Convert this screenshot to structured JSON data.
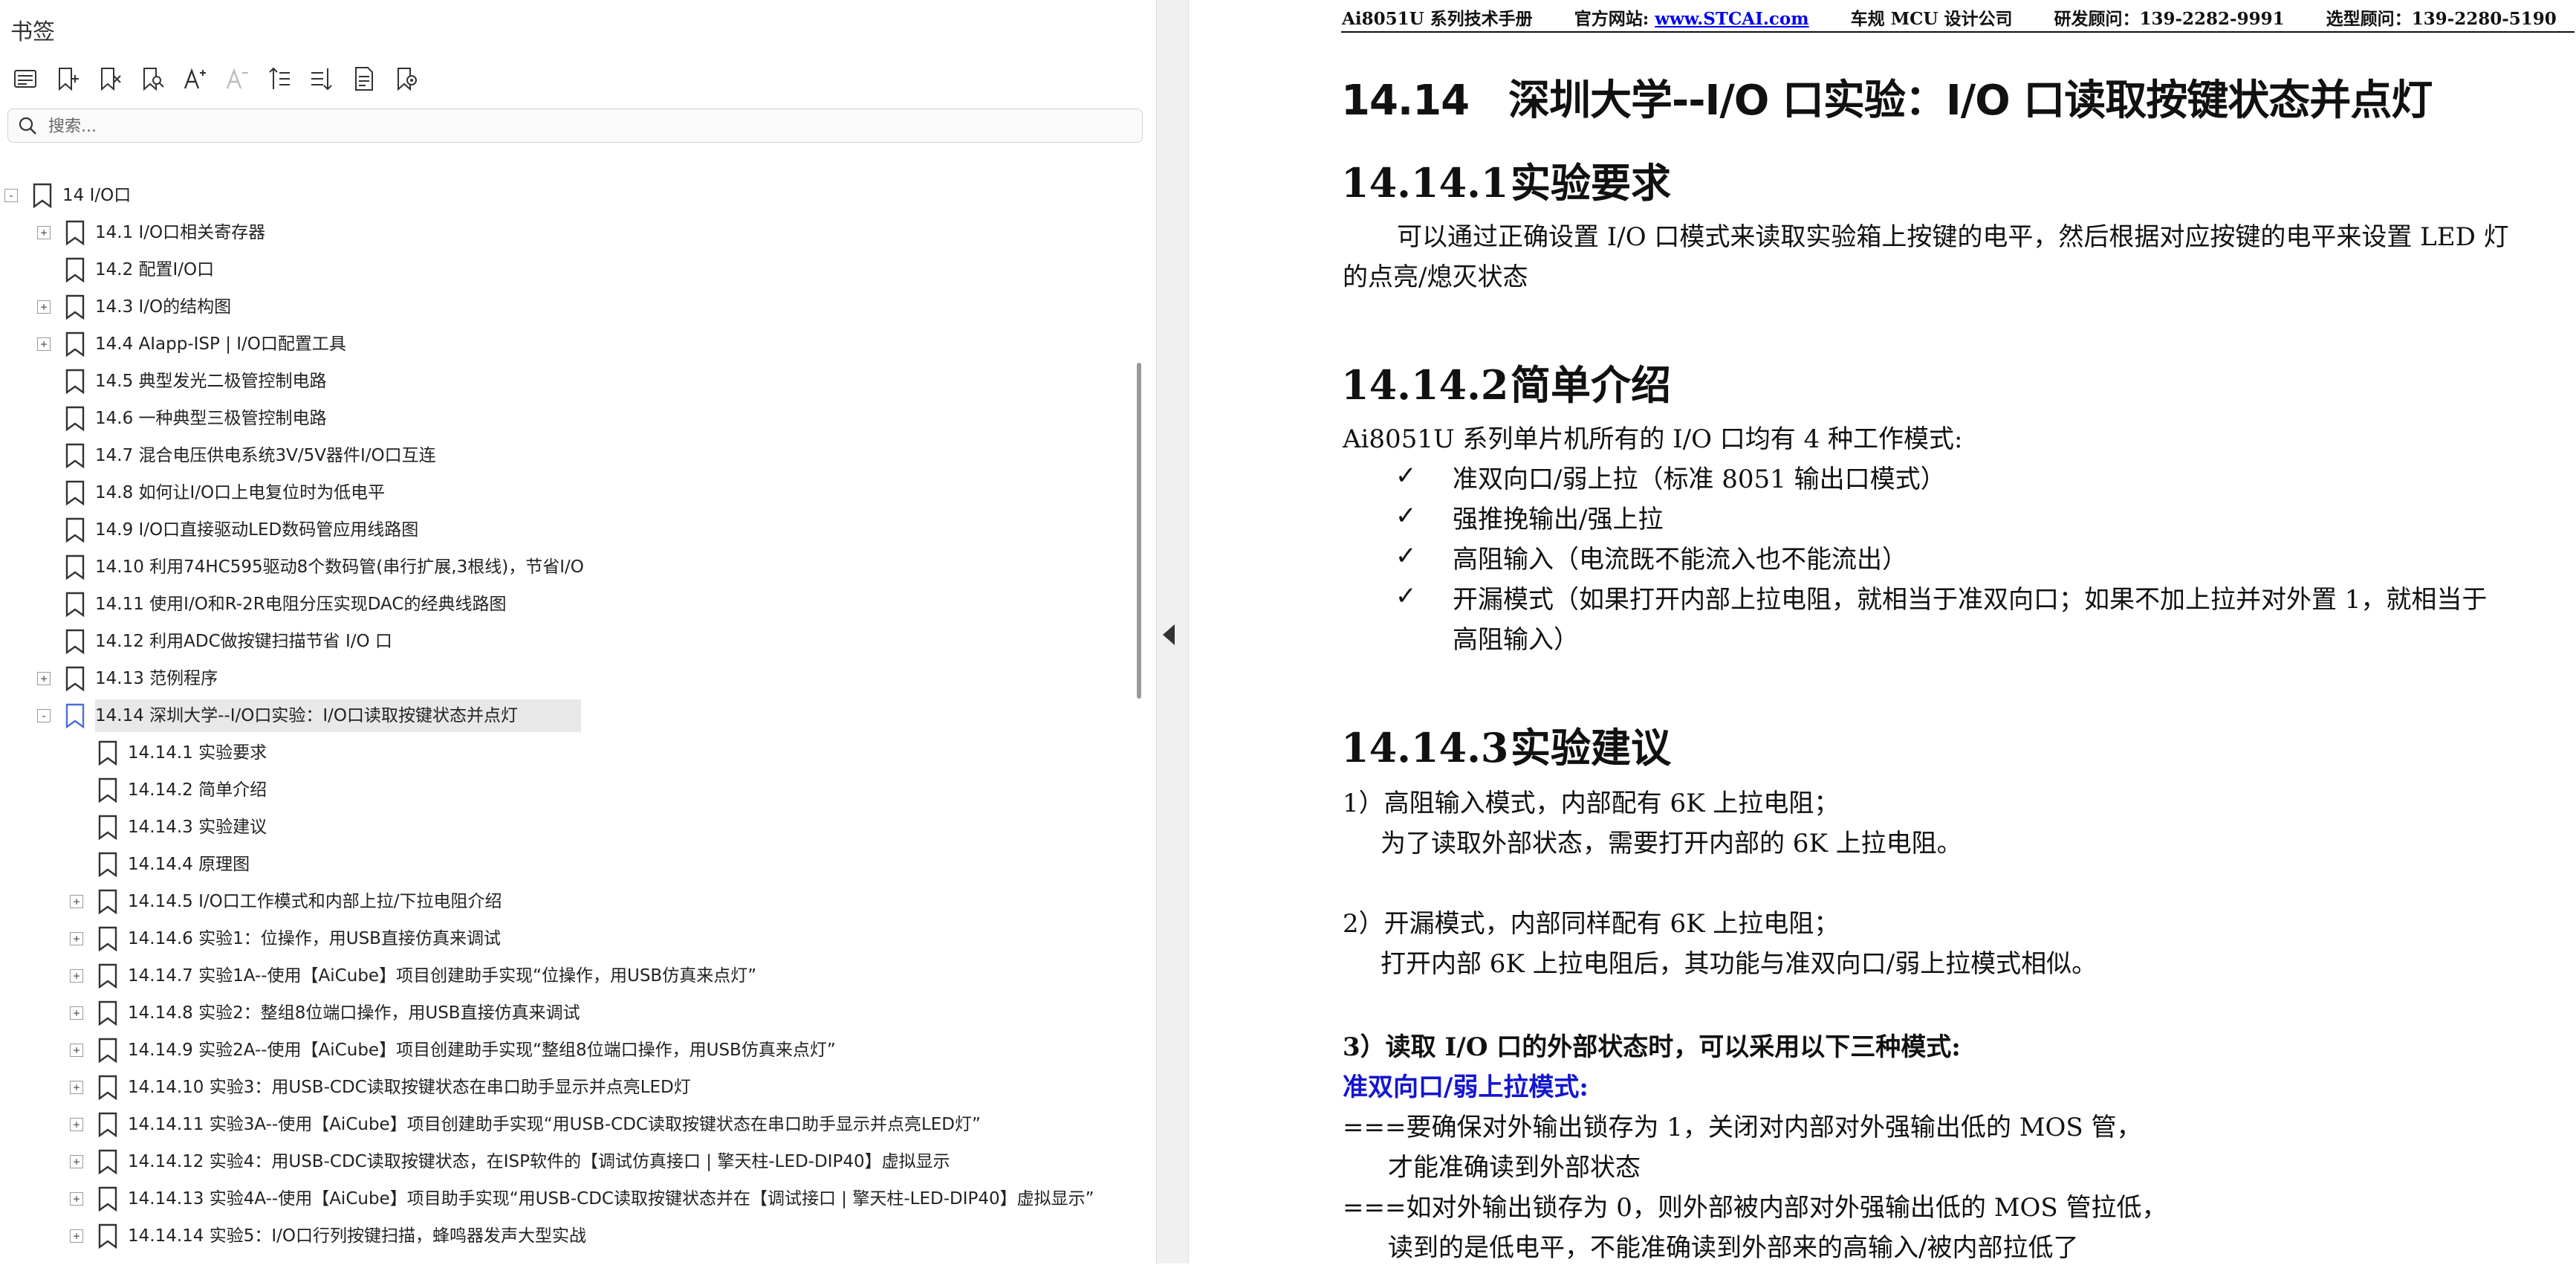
{
  "sidebar": {
    "title": "书签",
    "toolbar": [
      {
        "icon": "bookmark-list-icon"
      },
      {
        "icon": "add-bookmark-icon"
      },
      {
        "icon": "delete-bookmark-icon"
      },
      {
        "icon": "find-bookmark-icon"
      },
      {
        "icon": "font-increase-icon"
      },
      {
        "icon": "font-decrease-icon"
      },
      {
        "icon": "expand-all-icon"
      },
      {
        "icon": "collapse-all-icon"
      },
      {
        "icon": "bookmark-properties-icon"
      },
      {
        "icon": "bookmark-settings-icon"
      }
    ],
    "search_placeholder": "搜索...",
    "tree": [
      {
        "level": 0,
        "expander": "-",
        "label": "14  I/O口"
      },
      {
        "level": 1,
        "expander": "+",
        "label": "14.1  I/O口相关寄存器"
      },
      {
        "level": 1,
        "expander": "",
        "label": "14.2  配置I/O口"
      },
      {
        "level": 1,
        "expander": "+",
        "label": "14.3  I/O的结构图"
      },
      {
        "level": 1,
        "expander": "+",
        "label": "14.4  AIapp-ISP | I/O口配置工具"
      },
      {
        "level": 1,
        "expander": "",
        "label": "14.5  典型发光二极管控制电路"
      },
      {
        "level": 1,
        "expander": "",
        "label": "14.6  一种典型三极管控制电路"
      },
      {
        "level": 1,
        "expander": "",
        "label": "14.7  混合电压供电系统3V/5V器件I/O口互连"
      },
      {
        "level": 1,
        "expander": "",
        "label": "14.8  如何让I/O口上电复位时为低电平"
      },
      {
        "level": 1,
        "expander": "",
        "label": "14.9  I/O口直接驱动LED数码管应用线路图"
      },
      {
        "level": 1,
        "expander": "",
        "label": "14.10  利用74HC595驱动8个数码管(串行扩展,3根线)，节省I/O"
      },
      {
        "level": 1,
        "expander": "",
        "label": "14.11  使用I/O和R-2R电阻分压实现DAC的经典线路图"
      },
      {
        "level": 1,
        "expander": "",
        "label": "14.12  利用ADC做按键扫描节省 I/O 口"
      },
      {
        "level": 1,
        "expander": "+",
        "label": "14.13  范例程序"
      },
      {
        "level": 1,
        "expander": "-",
        "label": "14.14  深圳大学--I/O口实验：I/O口读取按键状态并点灯",
        "selected": true
      },
      {
        "level": 2,
        "expander": "",
        "label": "14.14.1 实验要求"
      },
      {
        "level": 2,
        "expander": "",
        "label": "14.14.2 简单介绍"
      },
      {
        "level": 2,
        "expander": "",
        "label": "14.14.3 实验建议"
      },
      {
        "level": 2,
        "expander": "",
        "label": "14.14.4 原理图"
      },
      {
        "level": 2,
        "expander": "+",
        "label": "14.14.5  I/O口工作模式和内部上拉/下拉电阻介绍"
      },
      {
        "level": 2,
        "expander": "+",
        "label": "14.14.6  实验1：位操作，用USB直接仿真来调试"
      },
      {
        "level": 2,
        "expander": "+",
        "label": "14.14.7  实验1A--使用【AiCube】项目创建助手实现“位操作，用USB仿真来点灯”"
      },
      {
        "level": 2,
        "expander": "+",
        "label": "14.14.8  实验2：整组8位端口操作，用USB直接仿真来调试"
      },
      {
        "level": 2,
        "expander": "+",
        "label": "14.14.9  实验2A--使用【AiCube】项目创建助手实现“整组8位端口操作，用USB仿真来点灯”"
      },
      {
        "level": 2,
        "expander": "+",
        "label": "14.14.10  实验3：用USB-CDC读取按键状态在串口助手显示并点亮LED灯"
      },
      {
        "level": 2,
        "expander": "+",
        "label": "14.14.11  实验3A--使用【AiCube】项目创建助手实现“用USB-CDC读取按键状态在串口助手显示并点亮LED灯”"
      },
      {
        "level": 2,
        "expander": "+",
        "label": "14.14.12  实验4：用USB-CDC读取按键状态，在ISP软件的【调试仿真接口 | 擎天柱-LED-DIP40】虚拟显示"
      },
      {
        "level": 2,
        "expander": "+",
        "label": "14.14.13  实验4A--使用【AiCube】项目助手实现“用USB-CDC读取按键状态并在【调试接口 | 擎天柱-LED-DIP40】虚拟显示”"
      },
      {
        "level": 2,
        "expander": "+",
        "label": "14.14.14  实验5：I/O口行列按键扫描，蜂鸣器发声大型实战"
      }
    ]
  },
  "document": {
    "header": {
      "manual": "Ai8051U 系列技术手册",
      "site_label": "官方网站: ",
      "site_url": "www.STCAI.com",
      "company": "车规 MCU 设计公司",
      "rd_contact": "研发顾问：139-2282-9991",
      "sales_contact": "选型顾问：139-2280-5190"
    },
    "h1": {
      "num": "14.14",
      "title": "深圳大学--I/O 口实验：I/O 口读取按键状态并点灯"
    },
    "sec1": {
      "num": "14.14.1",
      "title": "实验要求",
      "para_line1": "可以通过正确设置 I/O 口模式来读取实验箱上按键的电平，然后根据对应按键的电平来设置 LED 灯",
      "para_line2": "的点亮/熄灭状态"
    },
    "sec2": {
      "num": "14.14.2",
      "title": "简单介绍",
      "intro": "Ai8051U 系列单片机所有的 I/O 口均有 4 种工作模式:",
      "check_glyph": "✓",
      "items": [
        "准双向口/弱上拉（标准 8051 输出口模式）",
        "强推挽输出/强上拉",
        "高阻输入（电流既不能流入也不能流出）",
        "开漏模式（如果打开内部上拉电阻，就相当于准双向口；如果不加上拉并对外置 1，就相当于"
      ],
      "item4_cont": "高阻输入）"
    },
    "sec3": {
      "num": "14.14.3",
      "title": "实验建议",
      "p1": "1）高阻输入模式，内部配有 6K 上拉电阻；",
      "p1b": "为了读取外部状态，需要打开内部的 6K 上拉电阻。",
      "p2": "2）开漏模式，内部同样配有 6K 上拉电阻；",
      "p2b": "打开内部 6K 上拉电阻后，其功能与准双向口/弱上拉模式相似。",
      "p3": "3）读取 I/O 口的外部状态时，可以采用以下三种模式:",
      "blue": "准双向口/弱上拉模式:",
      "l1": "===要确保对外输出锁存为 1，关闭对内部对外强输出低的 MOS 管，",
      "l1b": "才能准确读到外部状态",
      "l2": "===如对外输出锁存为 0，则外部被内部对外强输出低的 MOS 管拉低，",
      "l2b": "读到的是低电平，不能准确读到外部来的高输入/被内部拉低了"
    }
  }
}
